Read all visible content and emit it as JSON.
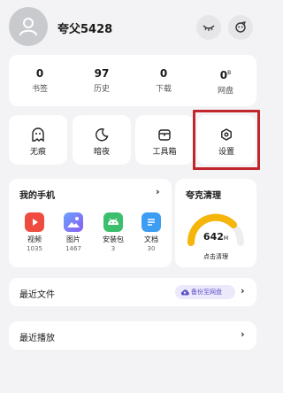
{
  "user": {
    "name": "夸父5428"
  },
  "stats": [
    {
      "value": "0",
      "label": "书签"
    },
    {
      "value": "97",
      "label": "历史"
    },
    {
      "value": "0",
      "label": "下载"
    },
    {
      "value": "0",
      "suffix": "B",
      "label": "网盘"
    }
  ],
  "tools": [
    {
      "label": "无痕",
      "icon": "ghost-icon"
    },
    {
      "label": "暗夜",
      "icon": "moon-icon"
    },
    {
      "label": "工具箱",
      "icon": "toolbox-icon"
    },
    {
      "label": "设置",
      "icon": "hexagon-gear-icon"
    }
  ],
  "phone": {
    "title": "我的手机",
    "items": [
      {
        "name": "视频",
        "count": "1035",
        "color": "#ef4b3f"
      },
      {
        "name": "图片",
        "count": "1467",
        "color": "#4e7cf0"
      },
      {
        "name": "安装包",
        "count": "3",
        "color": "#3cbf6c"
      },
      {
        "name": "文档",
        "count": "30",
        "color": "#3d9df2"
      }
    ]
  },
  "cleanup": {
    "title": "夸克清理",
    "value": "642",
    "unit": "M",
    "action": "点击清理",
    "accent": "#f5b50a"
  },
  "recent_files": {
    "label": "最近文件",
    "backup_label": "备份至网盘"
  },
  "recent_play": {
    "label": "最近播放"
  }
}
